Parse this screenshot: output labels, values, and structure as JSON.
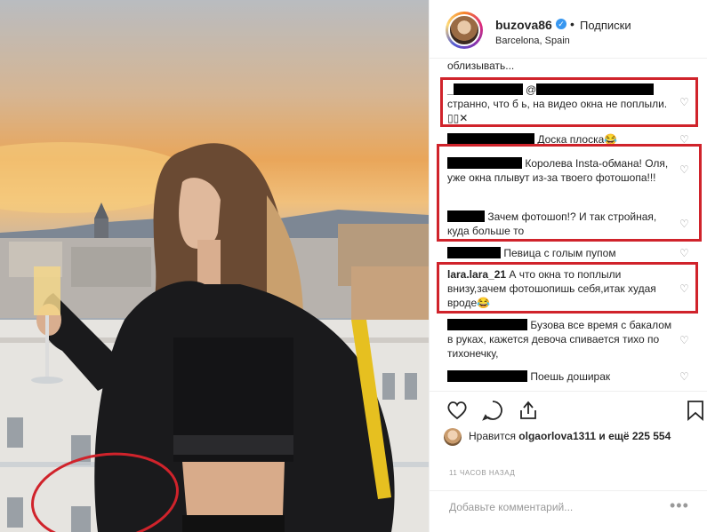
{
  "post": {
    "username": "buzova86",
    "verified_mark": "✓",
    "separator": "•",
    "follow_status": "Подписки",
    "location": "Barcelona, Spain"
  },
  "comments": [
    {
      "text": "облизывать..."
    },
    {
      "user": "_",
      "mention": "@",
      "text": "странно, что б   ь, на видео окна не поплыли.",
      "emoji": "✕",
      "highlighted": true
    },
    {
      "text": "Доска плоска😂"
    },
    {
      "text": "Королева Insta-обмана! Оля, уже окна плывут из-за твоего фотошопа!!!",
      "highlighted": true
    },
    {
      "text": "Зачем фотошоп!? И так стройная, куда больше то",
      "highlighted": true
    },
    {
      "text": "Певица с голым пупом"
    },
    {
      "user": "lara.lara_21",
      "text": "А что окна то поплыли внизу,зачем фотошопишь себя,итак худая вроде😂",
      "highlighted": true
    },
    {
      "text": "Бузова все время с бакалом в руках, кажется девоча спивается тихо по тихонечку,"
    },
    {
      "text": "Поешь доширак"
    }
  ],
  "likes": {
    "prefix": "Нравится",
    "user": "olgaorlova1311",
    "suffix": "и ещё 225 554"
  },
  "timestamp": "11 ЧАСОВ НАЗАД",
  "add_comment": {
    "placeholder": "Добавьте комментарий...",
    "more": "•••"
  },
  "icons": [
    "heart-icon",
    "comment-icon",
    "share-icon",
    "bookmark-icon"
  ],
  "colors": {
    "highlight_box": "#d0232b",
    "verified": "#3897f0",
    "text": "#262626",
    "muted": "#999999"
  }
}
